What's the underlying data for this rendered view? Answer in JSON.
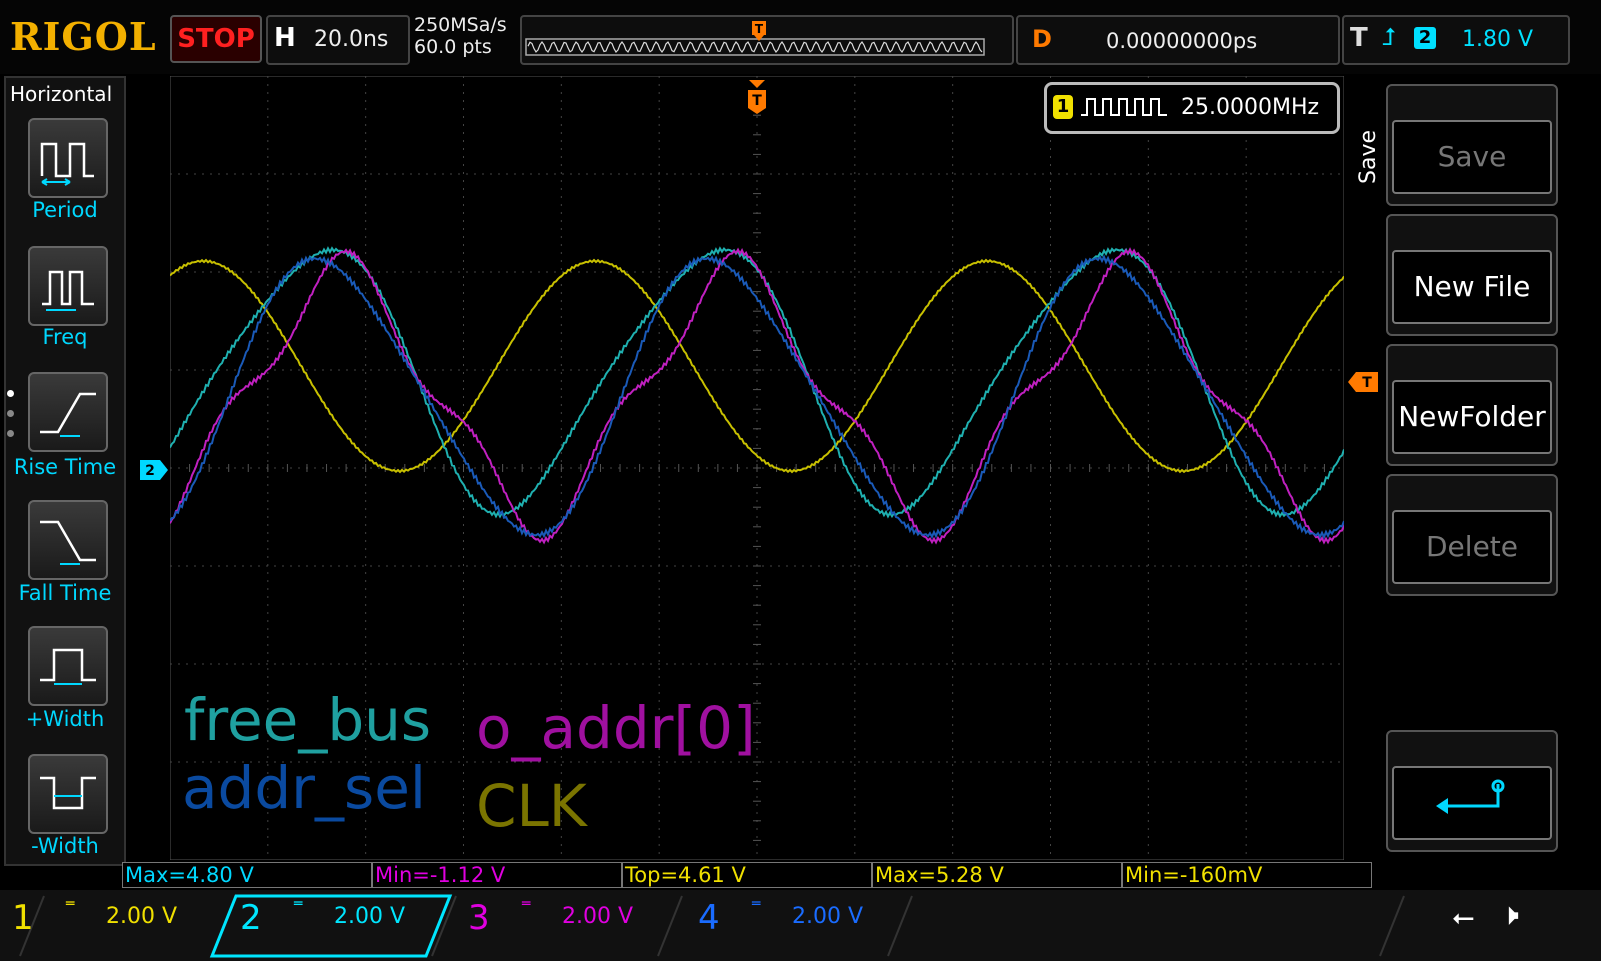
{
  "brand": "RIGOL",
  "run_state": "STOP",
  "timebase": {
    "label": "H",
    "value": "20.0ns"
  },
  "acquisition": {
    "sample_rate": "250MSa/s",
    "points": "60.0  pts"
  },
  "delay": {
    "label": "D",
    "value": "0.00000000ps"
  },
  "trigger": {
    "label": "T",
    "source": "2",
    "level": "1.80 V",
    "slope": "rising"
  },
  "frequency_counter": {
    "channel": "1",
    "value": "25.0000MHz"
  },
  "left_menu": {
    "title": "Horizontal",
    "items": [
      {
        "label": "Period",
        "icon": "period-icon"
      },
      {
        "label": "Freq",
        "icon": "freq-icon"
      },
      {
        "label": "Rise Time",
        "icon": "rise-time-icon"
      },
      {
        "label": "Fall Time",
        "icon": "fall-time-icon"
      },
      {
        "label": "+Width",
        "icon": "positive-width-icon"
      },
      {
        "label": "-Width",
        "icon": "negative-width-icon"
      }
    ]
  },
  "right_menu": {
    "title": "Save",
    "buttons": [
      {
        "label": "Save",
        "enabled": false
      },
      {
        "label": "New File",
        "enabled": true
      },
      {
        "label": "NewFolder",
        "enabled": true
      },
      {
        "label": "Delete",
        "enabled": false
      },
      {
        "label": "",
        "icon": "return-icon",
        "enabled": true
      }
    ]
  },
  "measurements": [
    "Max=4.80 V",
    "Min=-1.12 V",
    "Top=4.61 V",
    "Max=5.28 V",
    "Min=-160mV"
  ],
  "channels": [
    {
      "num": "1",
      "scale": "2.00 V",
      "color": "#f0e000"
    },
    {
      "num": "2",
      "scale": "2.00 V",
      "color": "#00e6ff"
    },
    {
      "num": "3",
      "scale": "2.00 V",
      "color": "#e000e0"
    },
    {
      "num": "4",
      "scale": "2.00 V",
      "color": "#1a6cff"
    }
  ],
  "signal_labels": {
    "free_bus": "free_bus",
    "o_addr": "o_addr[0]",
    "addr_sel": "addr_sel",
    "clk": "CLK"
  },
  "trace_colors": {
    "clk": "#c8c000",
    "free_bus": "#1fb0b0",
    "o_addr": "#c020c0",
    "addr_sel": "#1a5ab8"
  },
  "markers": {
    "ch2_ground": "2",
    "trigger_level": "T",
    "trigger_pos": "T"
  }
}
